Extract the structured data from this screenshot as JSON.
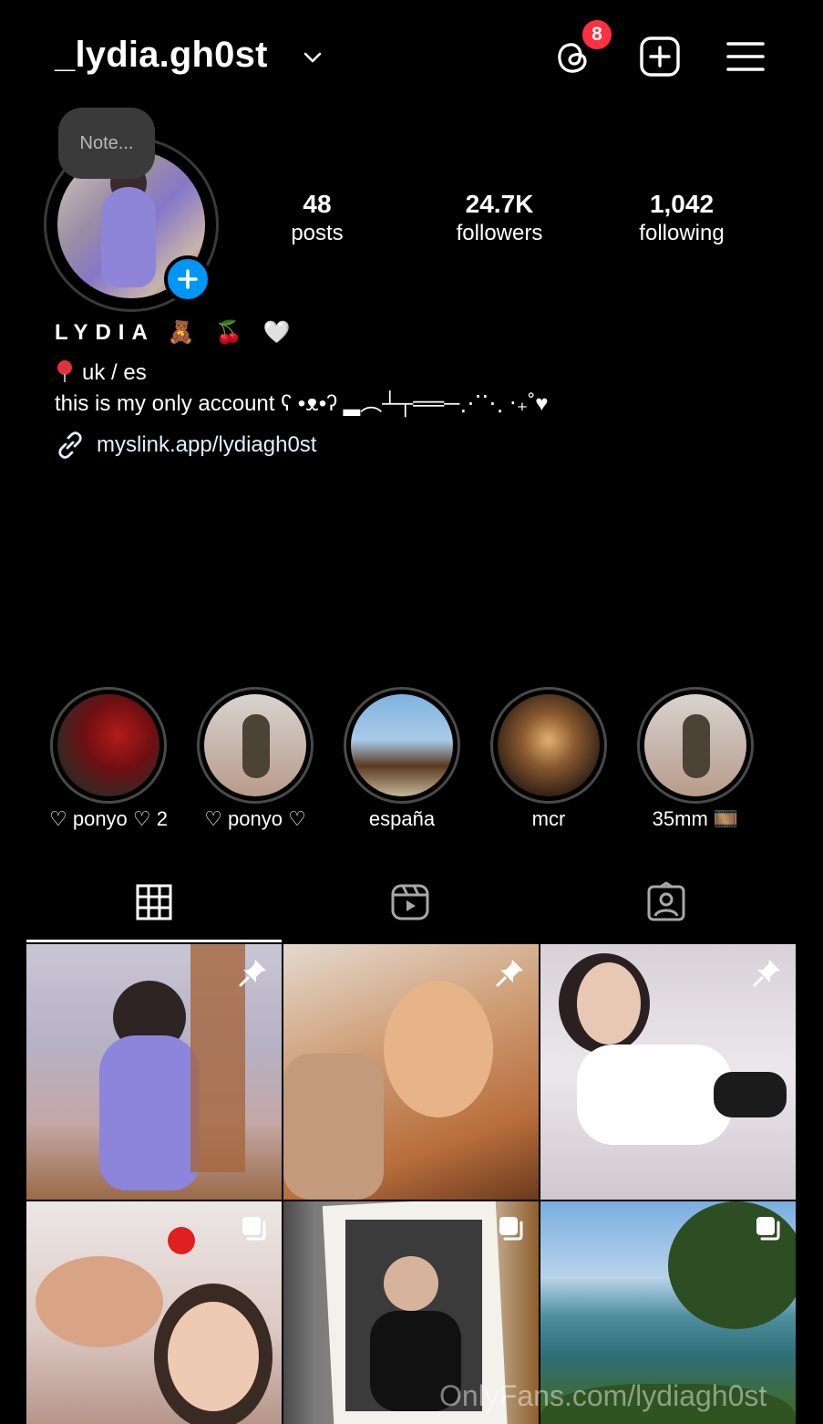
{
  "header": {
    "username": "_lydia.gh0st",
    "notifications_badge": "8",
    "icons": [
      "chevron-down-icon",
      "threads-icon",
      "add-post-icon",
      "menu-icon"
    ]
  },
  "profile": {
    "note_placeholder": "Note...",
    "stats": [
      {
        "value": "48",
        "label": "posts"
      },
      {
        "value": "24.7K",
        "label": "followers"
      },
      {
        "value": "1,042",
        "label": "following"
      }
    ],
    "display_name": "LYDIA 🧸 🍒 🤍",
    "bio_location": "uk / es",
    "bio_text": "this is my only account ʕ •ᴥ•ʔ ▂︵┴┬══─⋰⋱ ⋅₊˚♥",
    "link": "myslink.app/lydiagh0st"
  },
  "highlights": [
    {
      "label": "♡ ponyo ♡ 2"
    },
    {
      "label": "♡ ponyo ♡"
    },
    {
      "label": "españa"
    },
    {
      "label": "mcr"
    },
    {
      "label": "35mm 🎞️"
    }
  ],
  "tabs": [
    {
      "name": "grid-icon",
      "active": true
    },
    {
      "name": "reels-icon",
      "active": false
    },
    {
      "name": "tagged-icon",
      "active": false
    }
  ],
  "watermark": "OnlyFans.com/lydiagh0st",
  "colors": {
    "background": "#000000",
    "accent_blue": "#0095f6",
    "badge_red": "#ff3040"
  }
}
